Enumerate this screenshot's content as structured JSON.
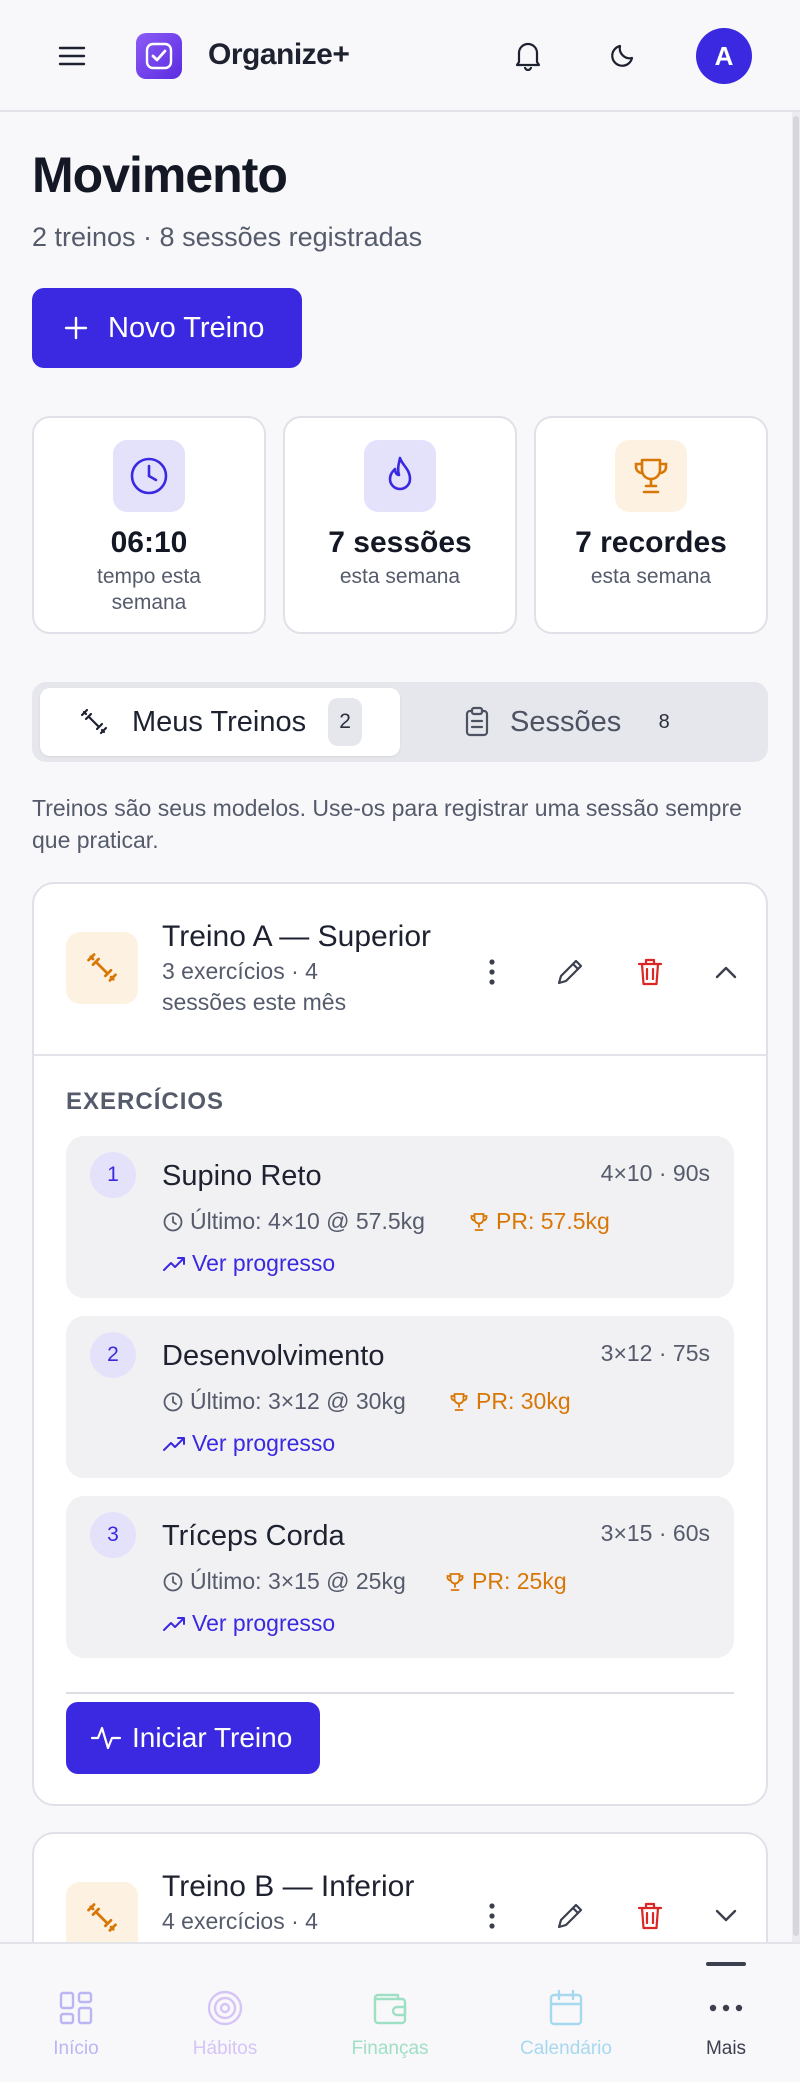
{
  "header": {
    "app_title": "Organize+",
    "menu_icon": "menu-icon",
    "notifications_icon": "bell-icon",
    "theme_icon": "moon-icon",
    "avatar_initial": "A"
  },
  "page": {
    "title": "Movimento",
    "subtitle": "2 treinos · 8 sessões registradas",
    "new_button_label": "Novo Treino"
  },
  "stats": [
    {
      "icon": "clock-icon",
      "value": "06:10",
      "label": "tempo esta semana",
      "color": "#3a29e0"
    },
    {
      "icon": "flame-icon",
      "value": "7 sessões",
      "label": "esta semana",
      "color": "#3a29e0"
    },
    {
      "icon": "trophy-icon",
      "value": "7 recordes",
      "label": "esta semana",
      "color": "#d97706"
    }
  ],
  "tabs": [
    {
      "label": "Meus Treinos",
      "count": "2",
      "icon": "dumbbell-icon",
      "active": true
    },
    {
      "label": "Sessões",
      "count": "8",
      "icon": "clipboard-icon",
      "active": false
    }
  ],
  "info_text": "Treinos são seus modelos. Use-os para registrar uma sessão sempre que praticar.",
  "workouts": [
    {
      "name": "Treino A — Superior",
      "meta": "3 exercícios · 4 sessões este mês",
      "expanded": true,
      "section_label": "EXERCÍCIOS",
      "exercises": [
        {
          "num": "1",
          "name": "Supino Reto",
          "sets": "4×10 · 90s",
          "last": "Último: 4×10 @ 57.5kg",
          "pr": "PR: 57.5kg",
          "link": "Ver progresso"
        },
        {
          "num": "2",
          "name": "Desenvolvimento",
          "sets": "3×12 · 75s",
          "last": "Último: 3×12 @ 30kg",
          "pr": "PR: 30kg",
          "link": "Ver progresso"
        },
        {
          "num": "3",
          "name": "Tríceps Corda",
          "sets": "3×15 · 60s",
          "last": "Último: 3×15 @ 25kg",
          "pr": "PR: 25kg",
          "link": "Ver progresso"
        }
      ],
      "start_label": "Iniciar Treino"
    },
    {
      "name": "Treino B — Inferior",
      "meta": "4 exercícios · 4",
      "expanded": false
    }
  ],
  "bottom_nav": [
    {
      "label": "Início",
      "icon": "grid-icon",
      "color": "#b9b6f3"
    },
    {
      "label": "Hábitos",
      "icon": "target-icon",
      "color": "#d6c4f7"
    },
    {
      "label": "Finanças",
      "icon": "wallet-icon",
      "color": "#9fe0c4"
    },
    {
      "label": "Calendário",
      "icon": "calendar-icon",
      "color": "#a6d8f0"
    },
    {
      "label": "Mais",
      "icon": "more-icon",
      "color": "#3b3f4e"
    }
  ],
  "colors": {
    "primary": "#3a29e0",
    "pr_orange": "#d97706",
    "danger": "#dc2626"
  }
}
